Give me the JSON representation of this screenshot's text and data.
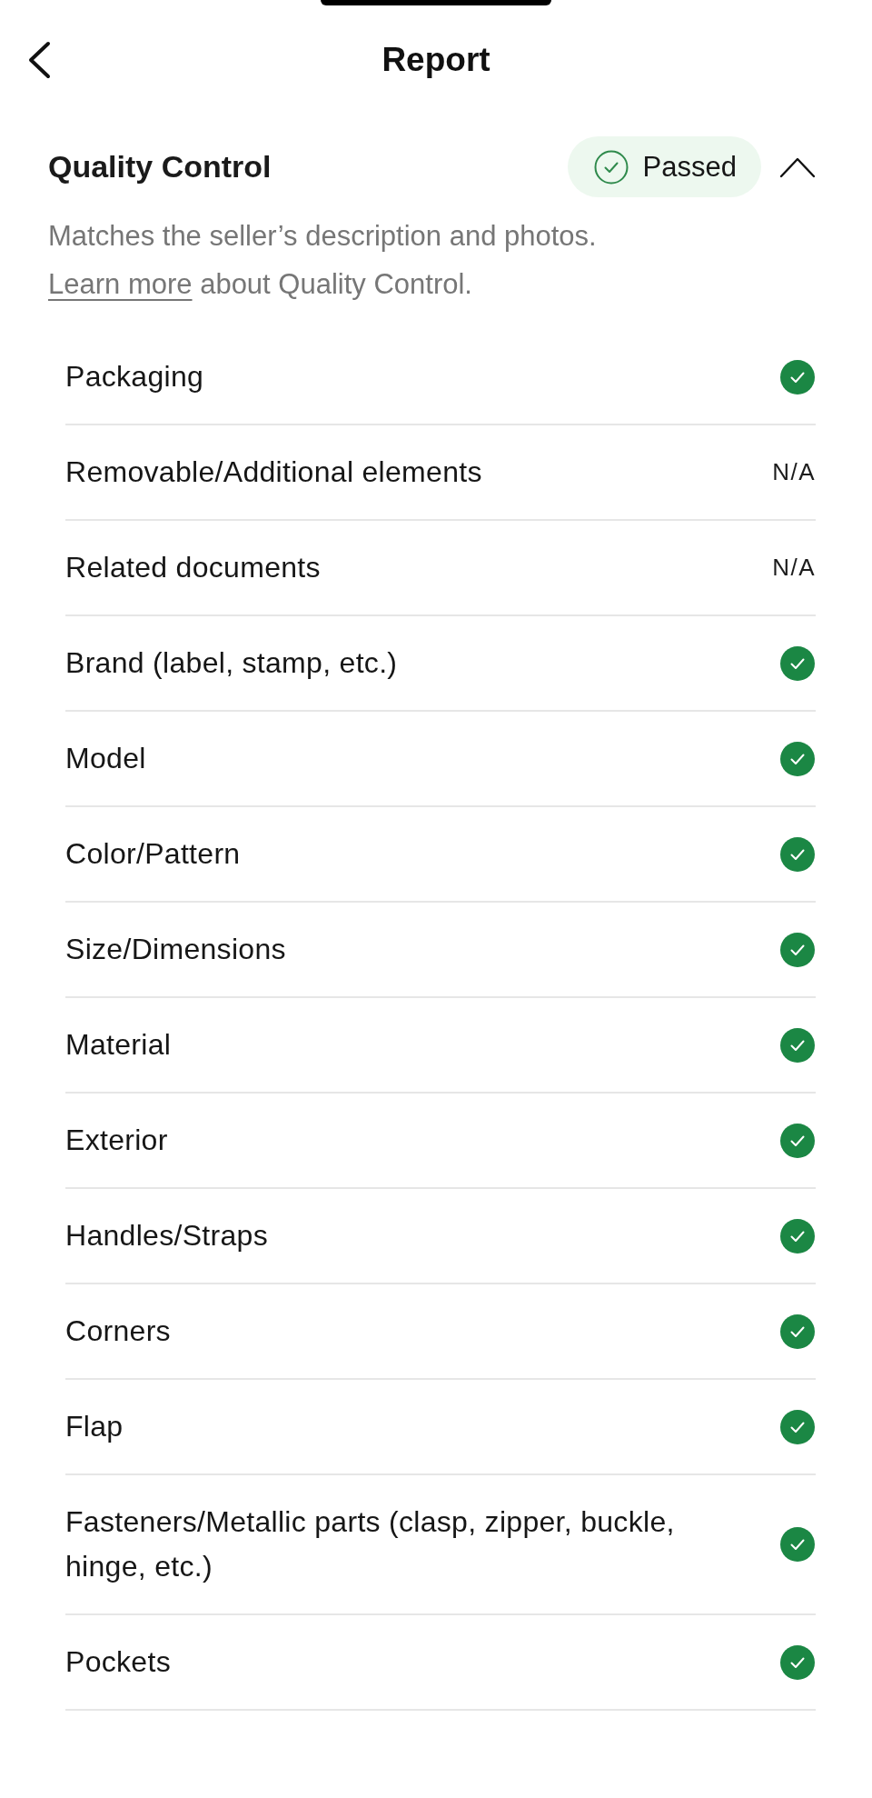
{
  "header": {
    "title": "Report"
  },
  "section": {
    "title": "Quality Control",
    "status": {
      "label": "Passed",
      "kind": "passed"
    },
    "expanded": true,
    "description": "Matches the seller’s description and photos.",
    "learn_more": {
      "link": "Learn more",
      "rest": "about Quality Control."
    }
  },
  "items": [
    {
      "label": "Packaging",
      "kind": "passed"
    },
    {
      "label": "Removable/Additional elements",
      "kind": "not_applicable",
      "value": "N/A"
    },
    {
      "label": "Related documents",
      "kind": "not_applicable",
      "value": "N/A"
    },
    {
      "label": "Brand (label, stamp, etc.)",
      "kind": "passed"
    },
    {
      "label": "Model",
      "kind": "passed"
    },
    {
      "label": "Color/Pattern",
      "kind": "passed"
    },
    {
      "label": "Size/Dimensions",
      "kind": "passed"
    },
    {
      "label": "Material",
      "kind": "passed"
    },
    {
      "label": "Exterior",
      "kind": "passed"
    },
    {
      "label": "Handles/Straps",
      "kind": "passed"
    },
    {
      "label": "Corners",
      "kind": "passed"
    },
    {
      "label": "Flap",
      "kind": "passed"
    },
    {
      "label": "Fasteners/Metallic parts (clasp, zipper, buckle, hinge, etc.)",
      "kind": "passed"
    },
    {
      "label": "Pockets",
      "kind": "passed"
    }
  ]
}
